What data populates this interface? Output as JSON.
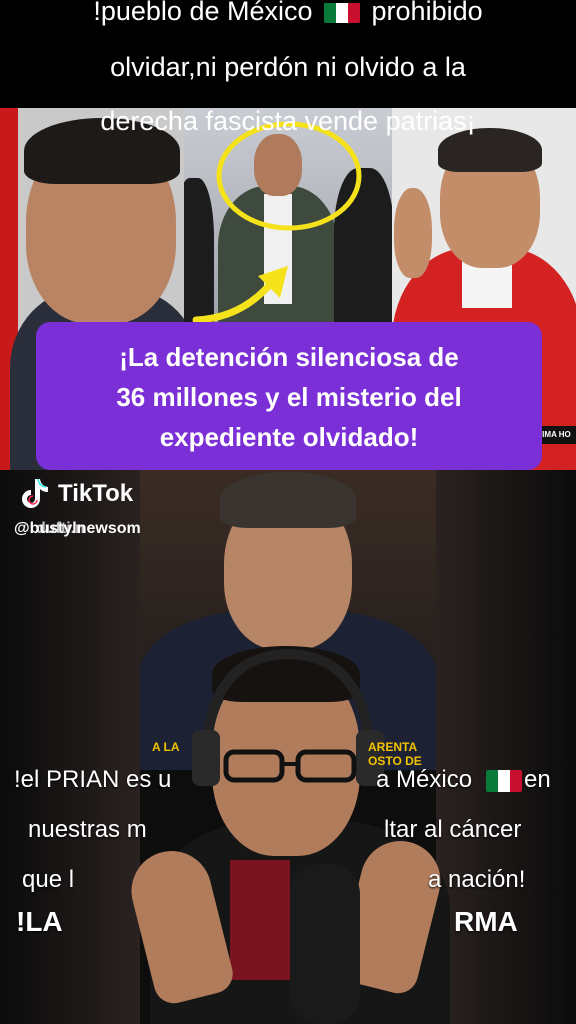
{
  "caption": {
    "line1_pre": "!pueblo de México",
    "line1_post": "prohibido",
    "line2": "olvidar,ni perdón ni olvido a la",
    "line3": "derecha fascista vende patrias¡"
  },
  "headline": {
    "line1": "¡La detención silenciosa de",
    "line2": "36 millones y el misterio del",
    "line3": "expediente olvidado!"
  },
  "collage": {
    "right_tag": "ALTIMA HO"
  },
  "tiktok": {
    "brand": "TikTok",
    "handle": "@bustylnewsom",
    "handle_overlap": "dufti.n"
  },
  "inner_video": {
    "tag_left": "A LA",
    "tag_right": "ARENTA",
    "tag_right2": "OSTO DE"
  },
  "subtitles": {
    "line1_pre": "!el PRIAN es u",
    "line1_mid": "a México",
    "line1_post": "en",
    "line2_a": "nuestras m",
    "line2_b": "ltar al cáncer",
    "line3_a": "que l",
    "line3_b": "a nación!",
    "line4_a": "!LA",
    "line4_b": "RMA"
  },
  "colors": {
    "headline_bg": "#7b2fd6",
    "highlight_circle": "#f5e21a",
    "flag_green": "#0a7a3a",
    "flag_red": "#c8102e"
  }
}
